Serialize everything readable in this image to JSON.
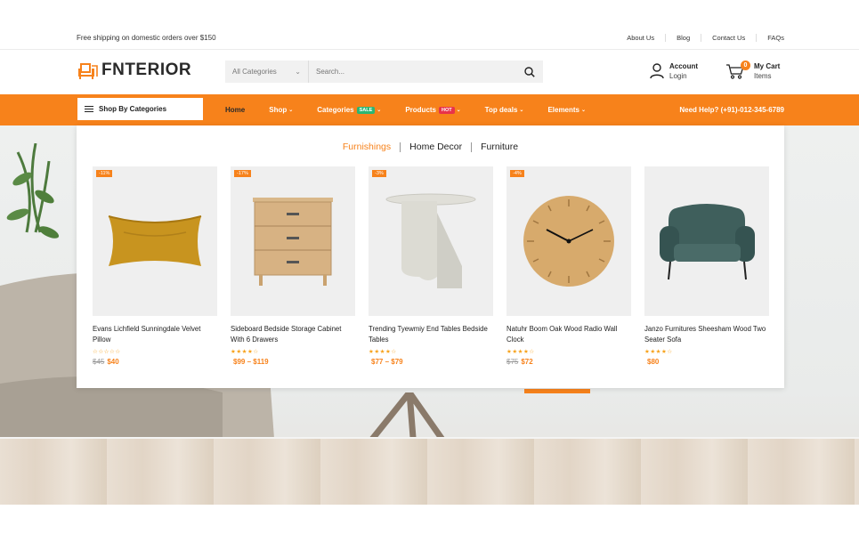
{
  "topbar": {
    "shipping": "Free shipping on domestic orders over $150",
    "links": [
      "About Us",
      "Blog",
      "Contact Us",
      "FAQs"
    ]
  },
  "header": {
    "logo_text": "FNTERIOR",
    "search": {
      "category": "All Categories",
      "placeholder": "Search..."
    },
    "account": {
      "title": "Account",
      "subtitle": "Login"
    },
    "cart": {
      "title": "My Cart",
      "subtitle": "Items",
      "count": "0"
    }
  },
  "nav": {
    "shop_by_categories": "Shop By Categories",
    "items": {
      "home": "Home",
      "shop": "Shop",
      "categories": "Categories",
      "categories_tag": "SALE",
      "products": "Products",
      "products_tag": "HOT",
      "top_deals": "Top deals",
      "elements": "Elements"
    },
    "help": "Need Help? (+91)-012-345-6789"
  },
  "menu": {
    "tabs": [
      "Furnishings",
      "Home Decor",
      "Furniture"
    ],
    "active_tab": "Furnishings",
    "products": [
      {
        "discount": "-11%",
        "name": "Evans Lichfield Sunningdale Velvet Pillow",
        "stars": "☆☆☆☆☆",
        "old_price": "$45",
        "price": "$40"
      },
      {
        "discount": "-17%",
        "name": "Sideboard Bedside Storage Cabinet With 6 Drawers",
        "stars": "★★★★☆",
        "old_price": "",
        "price": "$99 – $119"
      },
      {
        "discount": "-3%",
        "name": "Trending Tyewmiy End Tables Bedside Tables",
        "stars": "★★★★☆",
        "old_price": "",
        "price": "$77 – $79"
      },
      {
        "discount": "-4%",
        "name": "Natuhr Boom Oak Wood Radio Wall Clock",
        "stars": "★★★★☆",
        "old_price": "$75",
        "price": "$72"
      },
      {
        "discount": "",
        "name": "Janzo Furnitures Sheesham Wood Two Seater Sofa",
        "stars": "★★★★☆",
        "old_price": "",
        "price": "$80"
      }
    ]
  },
  "colors": {
    "accent": "#f7821b",
    "sale_tag": "#2bb673",
    "hot_tag": "#e8334a"
  },
  "icons": [
    "logo-chair-icon",
    "chevron-down-icon",
    "search-icon",
    "user-icon",
    "cart-icon",
    "menu-icon"
  ]
}
